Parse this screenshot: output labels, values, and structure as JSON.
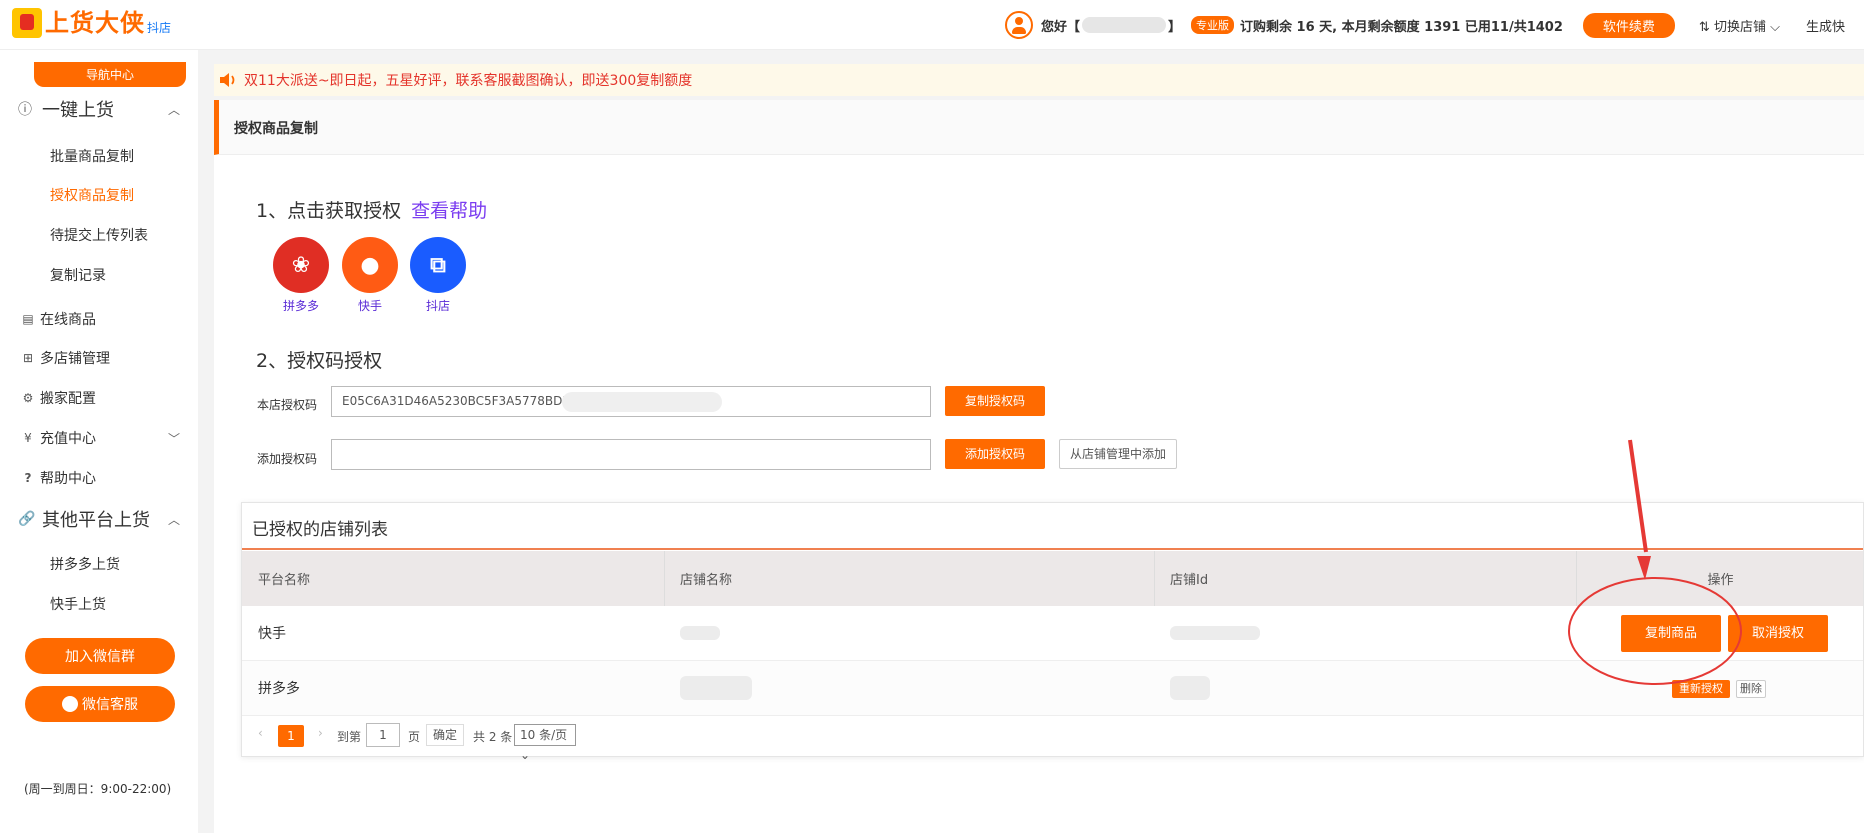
{
  "app": {
    "logo_text": "上货大侠",
    "logo_sub": "抖店"
  },
  "header": {
    "greeting": "您好【",
    "greeting_end": "】",
    "pro_badge": "专业版",
    "quota": "订购剩余 16 天, 本月剩余额度 1391 已用11/共1402",
    "renew_button": "软件续费",
    "switch_store": "切换店铺",
    "switch_store_icon": "chevron-down-icon",
    "generate": "生成快"
  },
  "sidebar": {
    "nav_center": "导航中心",
    "groups": [
      {
        "label": "一键上货",
        "icon": "upload-circle-icon",
        "items": [
          "批量商品复制",
          "授权商品复制",
          "待提交上传列表",
          "复制记录"
        ],
        "active_item": "授权商品复制"
      },
      {
        "label": "其他平台上货",
        "icon": "link-icon",
        "items": [
          "拼多多上货",
          "快手上货"
        ]
      }
    ],
    "links": [
      {
        "label": "在线商品",
        "icon": "list-icon"
      },
      {
        "label": "多店铺管理",
        "icon": "stores-icon"
      },
      {
        "label": "搬家配置",
        "icon": "gear-icon"
      },
      {
        "label": "充值中心",
        "icon": "yuan-icon"
      },
      {
        "label": "帮助中心",
        "icon": "question-icon"
      }
    ],
    "join_wechat_group": "加入微信群",
    "wechat_service": "微信客服",
    "service_hours": "(周一到周日：9:00-22:00)"
  },
  "notice": {
    "text": "双11大派送~即日起，五星好评，联系客服截图确认，即送300复制额度",
    "color": "#e4342b"
  },
  "page": {
    "tab_title": "授权商品复制",
    "step1_title": "1、点击获取授权",
    "help_link": "查看帮助",
    "platforms": [
      {
        "name": "拼多多",
        "color": "#e02e24"
      },
      {
        "name": "快手",
        "color": "#ff5b14"
      },
      {
        "name": "抖店",
        "color": "#1a5cff"
      }
    ],
    "step2_title": "2、授权码授权",
    "store_code_label": "本店授权码",
    "store_code_value": "E05C6A31D46A5230BC5F3A5778BDB6F1",
    "copy_code_button": "复制授权码",
    "add_code_label": "添加授权码",
    "add_code_placeholder": "",
    "add_code_button": "添加授权码",
    "add_from_store_button": "从店铺管理中添加"
  },
  "table": {
    "title": "已授权的店铺列表",
    "columns": [
      "平台名称",
      "店铺名称",
      "店铺Id",
      "操作"
    ],
    "rows": [
      {
        "platform": "快手",
        "actions": [
          "复制商品",
          "取消授权"
        ]
      },
      {
        "platform": "拼多多",
        "actions": [
          "重新授权",
          "删除"
        ]
      }
    ]
  },
  "pagination": {
    "current_page": "1",
    "goto_label": "到第",
    "goto_value": "1",
    "page_unit": "页",
    "confirm": "确定",
    "total": "共 2 条",
    "page_size": "10 条/页"
  },
  "colors": {
    "accent": "#ff6a00",
    "annotation": "#e53935"
  }
}
